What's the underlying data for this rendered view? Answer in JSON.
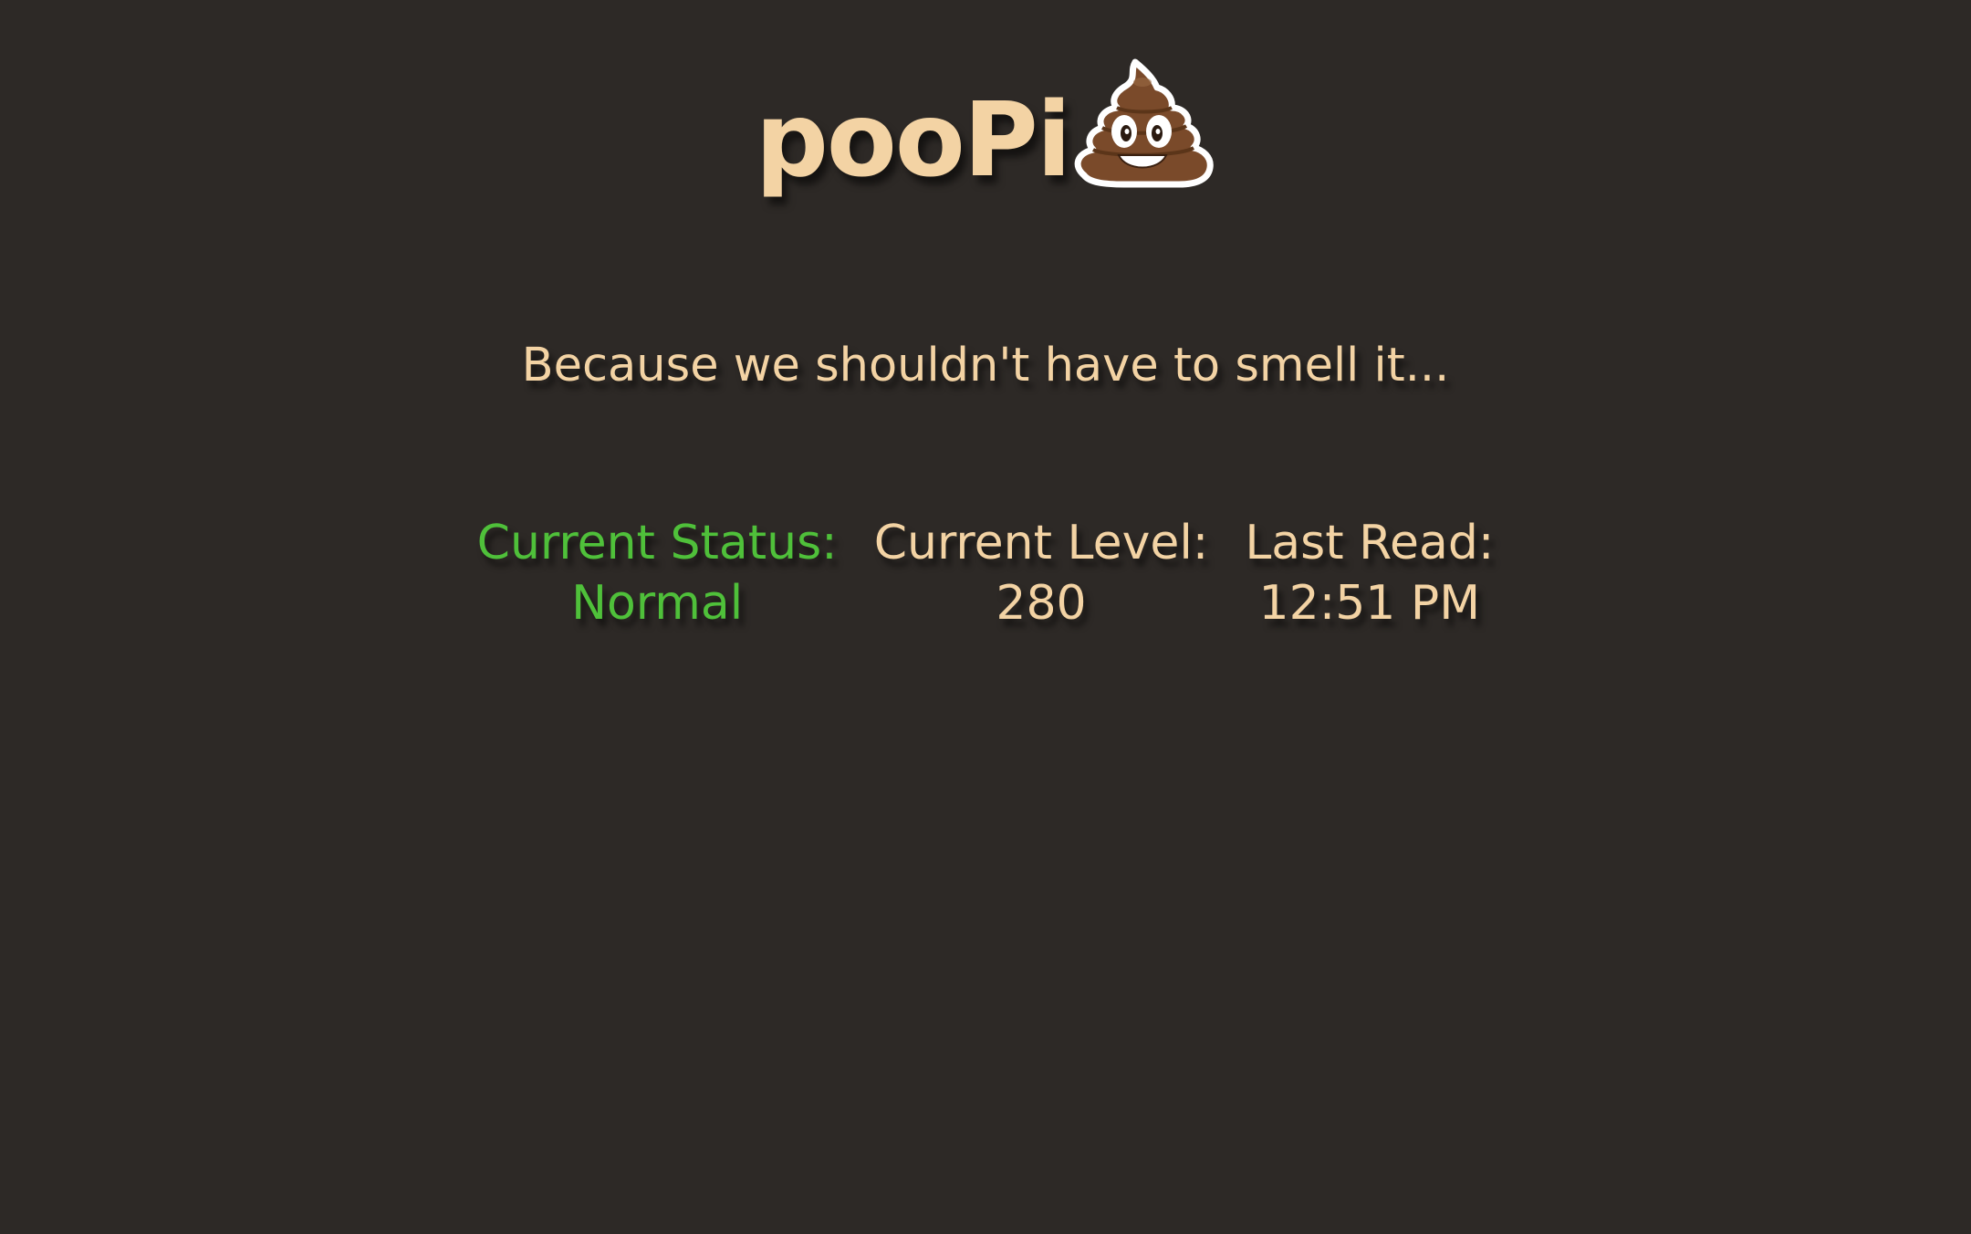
{
  "header": {
    "title": "pooPi",
    "logo_icon": "poo-emoji-icon"
  },
  "tagline": "Because we shouldn't have to smell it...",
  "stats": {
    "status": {
      "label": "Current Status:",
      "value": "Normal"
    },
    "level": {
      "label": "Current Level:",
      "value": "280"
    },
    "last_read": {
      "label": "Last Read:",
      "value": "12:51 PM"
    }
  },
  "colors": {
    "background": "#2d2926",
    "text": "#f3d3a4",
    "status_normal": "#4fc03a",
    "poo_brown": "#7a4a2a"
  }
}
